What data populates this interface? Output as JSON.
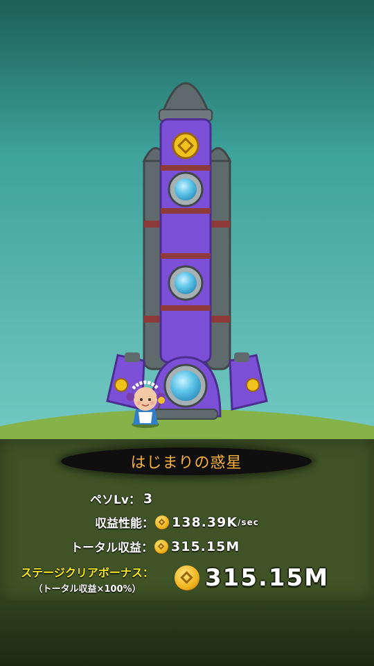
{
  "colors": {
    "sky_top": "#1c5f56",
    "sky_bottom": "#6cc7c1",
    "hill": "#86b24a",
    "rocket_body": "#7b4fd6",
    "rocket_grey": "#5f6a6d",
    "stripe": "#8f3a3a",
    "window": "#5fc5e8",
    "title_text": "#f6b03a",
    "bonus_label": "#f9e91c",
    "panel": "#3f5326"
  },
  "stage": {
    "title": "はじまりの惑星"
  },
  "stats": {
    "peso_level_label": "ペソLv：",
    "peso_level_value": "3",
    "income_label": "収益性能：",
    "income_value": "138.39K",
    "income_unit": "/sec",
    "total_label": "トータル収益：",
    "total_value": "315.15M",
    "bonus_label": "ステージクリアボーナス：",
    "bonus_sub": "（トータル収益×100%）",
    "bonus_value": "315.15M"
  },
  "icons": {
    "coin": "coin-icon"
  }
}
